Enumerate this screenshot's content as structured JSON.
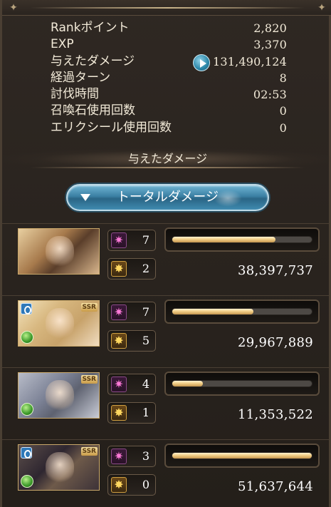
{
  "stats": [
    {
      "label": "Rankポイント",
      "value": "2,820"
    },
    {
      "label": "EXP",
      "value": "3,370"
    },
    {
      "label": "与えたダメージ",
      "value": "131,490,124"
    },
    {
      "label": "経過ターン",
      "value": "8"
    },
    {
      "label": "討伐時間",
      "value": "02:53"
    },
    {
      "label": "召喚石使用回数",
      "value": "0"
    },
    {
      "label": "エリクシール使用回数",
      "value": "0"
    }
  ],
  "section_title": "与えたダメージ",
  "total_button_label": "トータルダメージ",
  "characters": [
    {
      "attacks": "7",
      "ougi": "2",
      "damage": "38,397,737",
      "bar_fraction": 0.74,
      "ssr": "",
      "has_element": false,
      "has_ring": false
    },
    {
      "attacks": "7",
      "ougi": "5",
      "damage": "29,967,889",
      "bar_fraction": 0.58,
      "ssr": "SSR",
      "has_element": true,
      "has_ring": true
    },
    {
      "attacks": "4",
      "ougi": "1",
      "damage": "11,353,522",
      "bar_fraction": 0.22,
      "ssr": "SSR",
      "has_element": true,
      "has_ring": false
    },
    {
      "attacks": "3",
      "ougi": "0",
      "damage": "51,637,644",
      "bar_fraction": 1.0,
      "ssr": "SSR",
      "has_element": true,
      "has_ring": true
    }
  ],
  "icons": {
    "play": "play-icon",
    "attack": "star-burst-icon",
    "ougi": "charge-attack-icon",
    "collapse": "chevron-down-icon"
  }
}
